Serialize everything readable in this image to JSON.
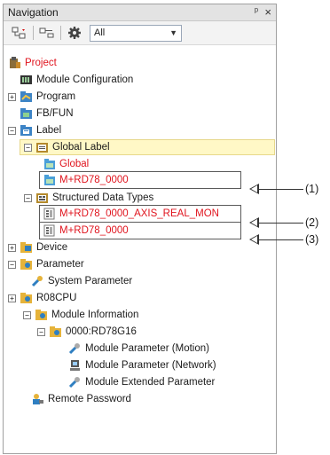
{
  "panel": {
    "title": "Navigation",
    "pin_glyph": "ᵖ",
    "close_glyph": "×"
  },
  "toolbar": {
    "filter_value": "All",
    "buttons": [
      "tree-view-icon",
      "collapse-view-icon",
      "settings-gear-icon"
    ]
  },
  "tree": {
    "project": "Project",
    "module_configuration": "Module Configuration",
    "program": "Program",
    "fb_fun": "FB/FUN",
    "label": "Label",
    "global_label": "Global Label",
    "global": "Global",
    "m_rd78_0000_label": "M+RD78_0000",
    "structured_data_types": "Structured Data Types",
    "axis_real_mon": "M+RD78_0000_AXIS_REAL_MON",
    "m_rd78_0000_struct": "M+RD78_0000",
    "device": "Device",
    "parameter": "Parameter",
    "system_parameter": "System Parameter",
    "r08cpu": "R08CPU",
    "module_information": "Module Information",
    "module_rd78g16": "0000:RD78G16",
    "module_parameter_motion": "Module Parameter (Motion)",
    "module_parameter_network": "Module Parameter (Network)",
    "module_extended_parameter": "Module Extended Parameter",
    "remote_password": "Remote Password"
  },
  "callouts": {
    "c1": "(1)",
    "c2": "(2)",
    "c3": "(3)"
  },
  "colors": {
    "red_text": "#e0141e",
    "selected_bg": "#fff8c6"
  }
}
